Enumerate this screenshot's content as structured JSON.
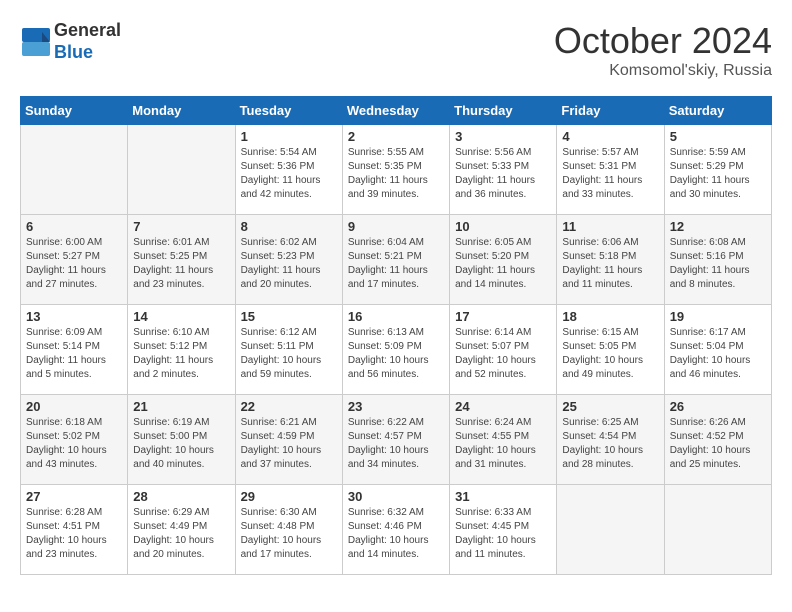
{
  "header": {
    "logo_line1": "General",
    "logo_line2": "Blue",
    "month": "October 2024",
    "location": "Komsomol'skiy, Russia"
  },
  "days_of_week": [
    "Sunday",
    "Monday",
    "Tuesday",
    "Wednesday",
    "Thursday",
    "Friday",
    "Saturday"
  ],
  "weeks": [
    [
      {
        "day": "",
        "info": ""
      },
      {
        "day": "",
        "info": ""
      },
      {
        "day": "1",
        "info": "Sunrise: 5:54 AM\nSunset: 5:36 PM\nDaylight: 11 hours and 42 minutes."
      },
      {
        "day": "2",
        "info": "Sunrise: 5:55 AM\nSunset: 5:35 PM\nDaylight: 11 hours and 39 minutes."
      },
      {
        "day": "3",
        "info": "Sunrise: 5:56 AM\nSunset: 5:33 PM\nDaylight: 11 hours and 36 minutes."
      },
      {
        "day": "4",
        "info": "Sunrise: 5:57 AM\nSunset: 5:31 PM\nDaylight: 11 hours and 33 minutes."
      },
      {
        "day": "5",
        "info": "Sunrise: 5:59 AM\nSunset: 5:29 PM\nDaylight: 11 hours and 30 minutes."
      }
    ],
    [
      {
        "day": "6",
        "info": "Sunrise: 6:00 AM\nSunset: 5:27 PM\nDaylight: 11 hours and 27 minutes."
      },
      {
        "day": "7",
        "info": "Sunrise: 6:01 AM\nSunset: 5:25 PM\nDaylight: 11 hours and 23 minutes."
      },
      {
        "day": "8",
        "info": "Sunrise: 6:02 AM\nSunset: 5:23 PM\nDaylight: 11 hours and 20 minutes."
      },
      {
        "day": "9",
        "info": "Sunrise: 6:04 AM\nSunset: 5:21 PM\nDaylight: 11 hours and 17 minutes."
      },
      {
        "day": "10",
        "info": "Sunrise: 6:05 AM\nSunset: 5:20 PM\nDaylight: 11 hours and 14 minutes."
      },
      {
        "day": "11",
        "info": "Sunrise: 6:06 AM\nSunset: 5:18 PM\nDaylight: 11 hours and 11 minutes."
      },
      {
        "day": "12",
        "info": "Sunrise: 6:08 AM\nSunset: 5:16 PM\nDaylight: 11 hours and 8 minutes."
      }
    ],
    [
      {
        "day": "13",
        "info": "Sunrise: 6:09 AM\nSunset: 5:14 PM\nDaylight: 11 hours and 5 minutes."
      },
      {
        "day": "14",
        "info": "Sunrise: 6:10 AM\nSunset: 5:12 PM\nDaylight: 11 hours and 2 minutes."
      },
      {
        "day": "15",
        "info": "Sunrise: 6:12 AM\nSunset: 5:11 PM\nDaylight: 10 hours and 59 minutes."
      },
      {
        "day": "16",
        "info": "Sunrise: 6:13 AM\nSunset: 5:09 PM\nDaylight: 10 hours and 56 minutes."
      },
      {
        "day": "17",
        "info": "Sunrise: 6:14 AM\nSunset: 5:07 PM\nDaylight: 10 hours and 52 minutes."
      },
      {
        "day": "18",
        "info": "Sunrise: 6:15 AM\nSunset: 5:05 PM\nDaylight: 10 hours and 49 minutes."
      },
      {
        "day": "19",
        "info": "Sunrise: 6:17 AM\nSunset: 5:04 PM\nDaylight: 10 hours and 46 minutes."
      }
    ],
    [
      {
        "day": "20",
        "info": "Sunrise: 6:18 AM\nSunset: 5:02 PM\nDaylight: 10 hours and 43 minutes."
      },
      {
        "day": "21",
        "info": "Sunrise: 6:19 AM\nSunset: 5:00 PM\nDaylight: 10 hours and 40 minutes."
      },
      {
        "day": "22",
        "info": "Sunrise: 6:21 AM\nSunset: 4:59 PM\nDaylight: 10 hours and 37 minutes."
      },
      {
        "day": "23",
        "info": "Sunrise: 6:22 AM\nSunset: 4:57 PM\nDaylight: 10 hours and 34 minutes."
      },
      {
        "day": "24",
        "info": "Sunrise: 6:24 AM\nSunset: 4:55 PM\nDaylight: 10 hours and 31 minutes."
      },
      {
        "day": "25",
        "info": "Sunrise: 6:25 AM\nSunset: 4:54 PM\nDaylight: 10 hours and 28 minutes."
      },
      {
        "day": "26",
        "info": "Sunrise: 6:26 AM\nSunset: 4:52 PM\nDaylight: 10 hours and 25 minutes."
      }
    ],
    [
      {
        "day": "27",
        "info": "Sunrise: 6:28 AM\nSunset: 4:51 PM\nDaylight: 10 hours and 23 minutes."
      },
      {
        "day": "28",
        "info": "Sunrise: 6:29 AM\nSunset: 4:49 PM\nDaylight: 10 hours and 20 minutes."
      },
      {
        "day": "29",
        "info": "Sunrise: 6:30 AM\nSunset: 4:48 PM\nDaylight: 10 hours and 17 minutes."
      },
      {
        "day": "30",
        "info": "Sunrise: 6:32 AM\nSunset: 4:46 PM\nDaylight: 10 hours and 14 minutes."
      },
      {
        "day": "31",
        "info": "Sunrise: 6:33 AM\nSunset: 4:45 PM\nDaylight: 10 hours and 11 minutes."
      },
      {
        "day": "",
        "info": ""
      },
      {
        "day": "",
        "info": ""
      }
    ]
  ]
}
